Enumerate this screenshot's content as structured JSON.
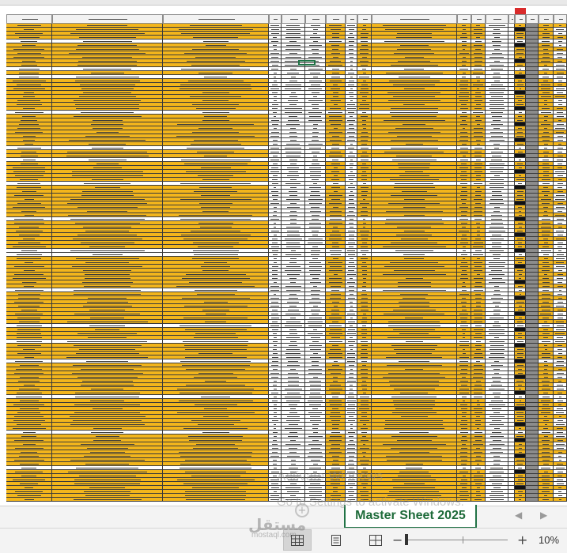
{
  "sheet": {
    "tab_label": "Master Sheet 2025",
    "zoom_label": "10%",
    "zoom_percent": 10
  },
  "watermark": {
    "line1": "Activate Windows",
    "line2": "Go to Settings to activate Windows."
  },
  "logo": {
    "text": "مستقل",
    "sub": "mostaql.com"
  },
  "colors": {
    "row_fill": "#f2b51c",
    "header_fill": "#f2f2f2",
    "grid_line": "#3a3a3a",
    "accent": "#217346",
    "tab_text": "#1e6b3a"
  },
  "icons": {
    "prev_sheet": "triangle-left-icon",
    "next_sheet": "triangle-right-icon",
    "normal_view": "grid-icon",
    "page_layout_view": "page-layout-icon",
    "page_break_view": "page-break-icon",
    "zoom_out": "minus-icon",
    "zoom_in": "plus-icon"
  }
}
